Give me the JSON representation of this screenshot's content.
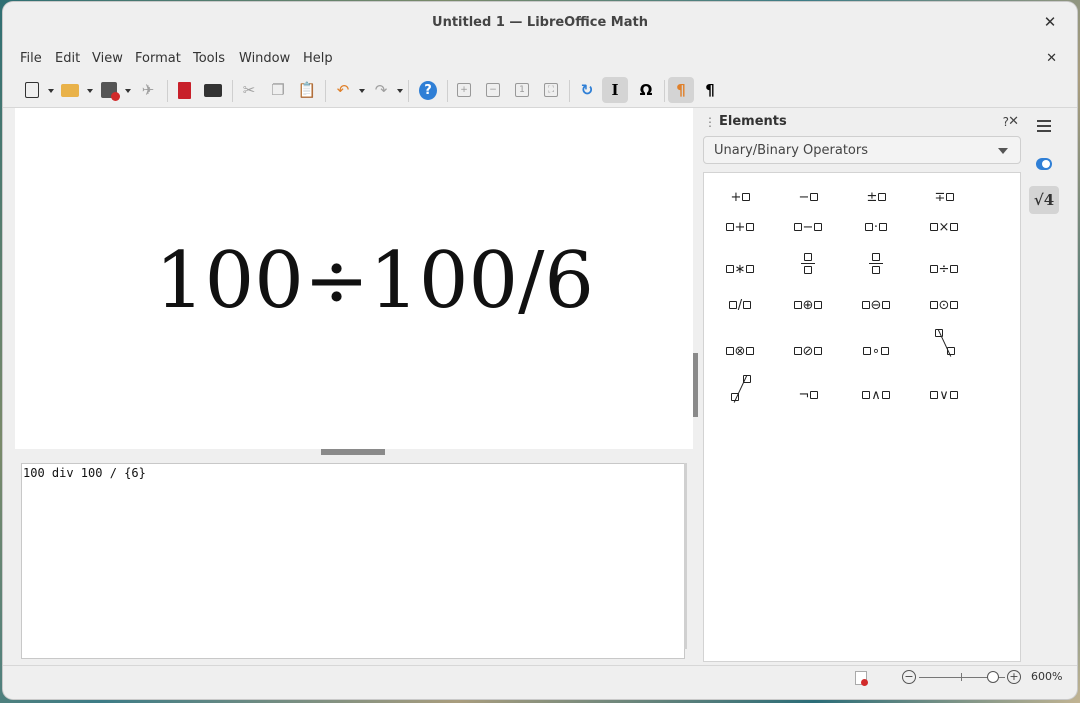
{
  "window": {
    "title": "Untitled 1 — LibreOffice Math",
    "close_label": "✕",
    "doc_close_label": "✕"
  },
  "menu": [
    "File",
    "Edit",
    "View",
    "Format",
    "Tools",
    "Window",
    "Help"
  ],
  "toolbar": {
    "icons": [
      "new-formula-icon",
      "open-folder-icon",
      "save-icon",
      "send-icon",
      "export-pdf-icon",
      "print-icon",
      "cut-icon",
      "copy-icon",
      "paste-icon",
      "undo-icon",
      "redo-icon",
      "help-icon",
      "zoom-in-icon",
      "zoom-out-icon",
      "show-all-icon",
      "zoom-fit-icon",
      "update-icon",
      "formula-cursor-icon",
      "symbols-icon",
      "elements-dock-icon",
      "import-mathml-icon"
    ],
    "help_glyph": "?",
    "symbols_glyph": "Ω",
    "cursor_glyph": "I",
    "pilcrow_glyph": "¶"
  },
  "formula": {
    "rendered": "100÷100/6"
  },
  "command": {
    "text": "100 div 100 / {6}"
  },
  "elements_panel": {
    "title": "Elements",
    "help_label": "?",
    "close_label": "✕",
    "category": "Unary/Binary Operators",
    "operators": {
      "plus": "+",
      "minus": "−",
      "plusminus": "±",
      "minusplus": "∓",
      "times": "×",
      "cdot": "·",
      "ast": "∗",
      "div": "÷",
      "slash": "/",
      "oplus": "⊕",
      "ominus": "⊖",
      "odot": "⊙",
      "otimes": "⊗",
      "oslash": "⊘",
      "circ": "∘",
      "neg": "¬",
      "and": "∧",
      "or": "∨"
    }
  },
  "sidebar": {
    "formula_glyph": "√4"
  },
  "status": {
    "zoom": "600%"
  },
  "colors": {
    "accent": "#2f7fd6",
    "pdf_red": "#c8202a",
    "folder": "#e9b249"
  }
}
